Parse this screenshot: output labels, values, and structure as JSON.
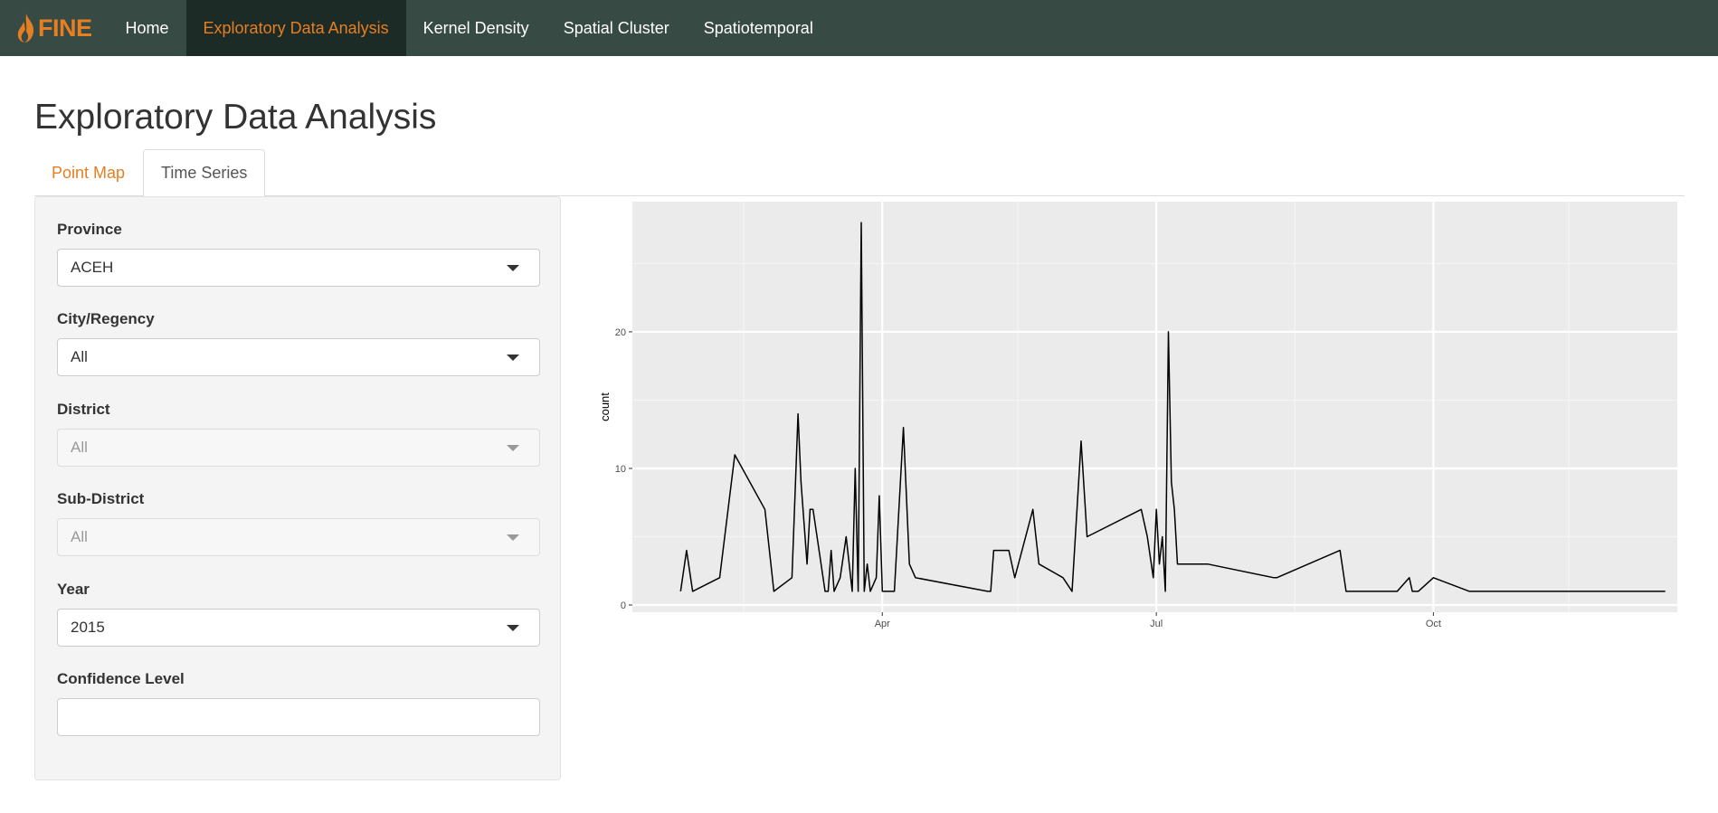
{
  "brand": {
    "name": "FINE",
    "logo_icon": "flame-icon",
    "color": "#e67e22"
  },
  "nav": {
    "items": [
      {
        "label": "Home"
      },
      {
        "label": "Exploratory Data Analysis"
      },
      {
        "label": "Kernel Density"
      },
      {
        "label": "Spatial Cluster"
      },
      {
        "label": "Spatiotemporal"
      }
    ],
    "active_index": 1,
    "bar_color": "#374a44",
    "active_bg": "#1d2b27"
  },
  "page": {
    "title": "Exploratory Data Analysis"
  },
  "tabs": [
    {
      "label": "Point Map",
      "active": false
    },
    {
      "label": "Time Series",
      "active": true
    }
  ],
  "sidebar": {
    "province": {
      "label": "Province",
      "value": "ACEH"
    },
    "city": {
      "label": "City/Regency",
      "value": "All"
    },
    "district": {
      "label": "District",
      "value": "All",
      "disabled": true
    },
    "subdistrict": {
      "label": "Sub-District",
      "value": "All",
      "disabled": true
    },
    "year": {
      "label": "Year",
      "value": "2015"
    },
    "confidence": {
      "label": "Confidence Level",
      "value": ""
    }
  },
  "chart_data": {
    "type": "line",
    "title": "",
    "xlabel": "",
    "ylabel": "count",
    "y_ticks": [
      0,
      10,
      20
    ],
    "ylim": [
      0,
      29
    ],
    "x_ticks": [
      "Apr",
      "Jul",
      "Oct"
    ],
    "xlim": [
      "2015-01-08",
      "2015-12-21"
    ],
    "grid": true,
    "panel_color": "#ebebeb",
    "line_color": "#000000",
    "series": [
      {
        "x": [
          "2015-01-24",
          "2015-01-26",
          "2015-01-28",
          "2015-02-06",
          "2015-02-11",
          "2015-02-21",
          "2015-02-24",
          "2015-03-02",
          "2015-03-04",
          "2015-03-05",
          "2015-03-07",
          "2015-03-08",
          "2015-03-09",
          "2015-03-13",
          "2015-03-14",
          "2015-03-15",
          "2015-03-16",
          "2015-03-18",
          "2015-03-20",
          "2015-03-22",
          "2015-03-23",
          "2015-03-24",
          "2015-03-25",
          "2015-03-26",
          "2015-03-27",
          "2015-03-28",
          "2015-03-30",
          "2015-03-31",
          "2015-04-01",
          "2015-04-05",
          "2015-04-08",
          "2015-04-10",
          "2015-04-12",
          "2015-05-06",
          "2015-05-07",
          "2015-05-08",
          "2015-05-13",
          "2015-05-15",
          "2015-05-21",
          "2015-05-23",
          "2015-05-31",
          "2015-06-03",
          "2015-06-06",
          "2015-06-08",
          "2015-06-26",
          "2015-06-28",
          "2015-06-30",
          "2015-07-01",
          "2015-07-02",
          "2015-07-03",
          "2015-07-04",
          "2015-07-05",
          "2015-07-06",
          "2015-07-07",
          "2015-07-08",
          "2015-07-18",
          "2015-08-09",
          "2015-08-10",
          "2015-08-31",
          "2015-09-02",
          "2015-09-19",
          "2015-09-23",
          "2015-09-24",
          "2015-09-25",
          "2015-09-26",
          "2015-10-01",
          "2015-10-13",
          "2015-12-17"
        ],
        "values": [
          1,
          4,
          1,
          2,
          11,
          7,
          1,
          2,
          14,
          9,
          3,
          7,
          7,
          1,
          1,
          4,
          1,
          2,
          5,
          1,
          10,
          1,
          28,
          1,
          3,
          1,
          2,
          8,
          1,
          1,
          13,
          3,
          2,
          1,
          1,
          4,
          4,
          2,
          7,
          3,
          2,
          1,
          12,
          5,
          7,
          5,
          2,
          7,
          3,
          5,
          1,
          20,
          9,
          7,
          3,
          3,
          2,
          2,
          4,
          1,
          1,
          2,
          1,
          1,
          1,
          2,
          1,
          1
        ]
      }
    ]
  }
}
